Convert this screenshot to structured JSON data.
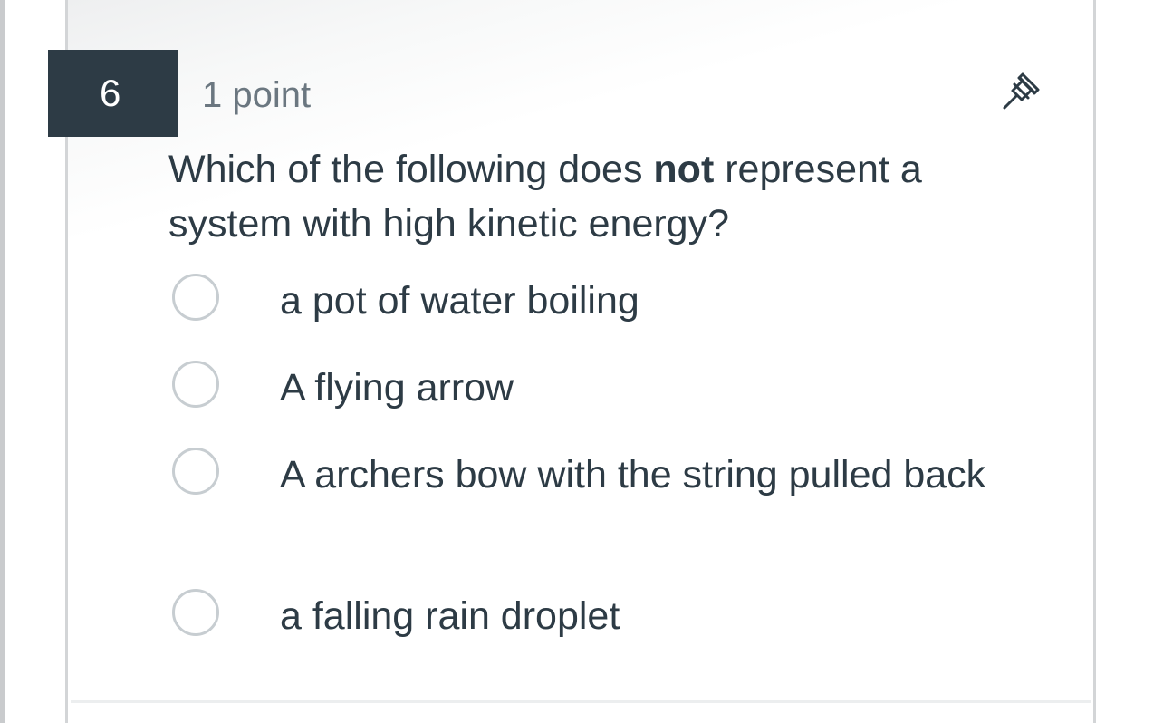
{
  "question": {
    "number": "6",
    "points": "1 point",
    "text_before": "Which of the following does ",
    "text_emphasis": "not",
    "text_after": " represent a system with high kinetic energy?",
    "pin_icon": "pin-icon"
  },
  "options": [
    {
      "label": "a pot of water boiling",
      "selected": false
    },
    {
      "label": "A flying arrow",
      "selected": false
    },
    {
      "label": "A archers bow with the string pulled back",
      "selected": false
    },
    {
      "label": "a falling rain droplet",
      "selected": false
    }
  ],
  "colors": {
    "header_block": "#2d3b45",
    "text": "#2d3b45",
    "muted_text": "#6b7780",
    "radio_border": "#c7cdd1"
  }
}
